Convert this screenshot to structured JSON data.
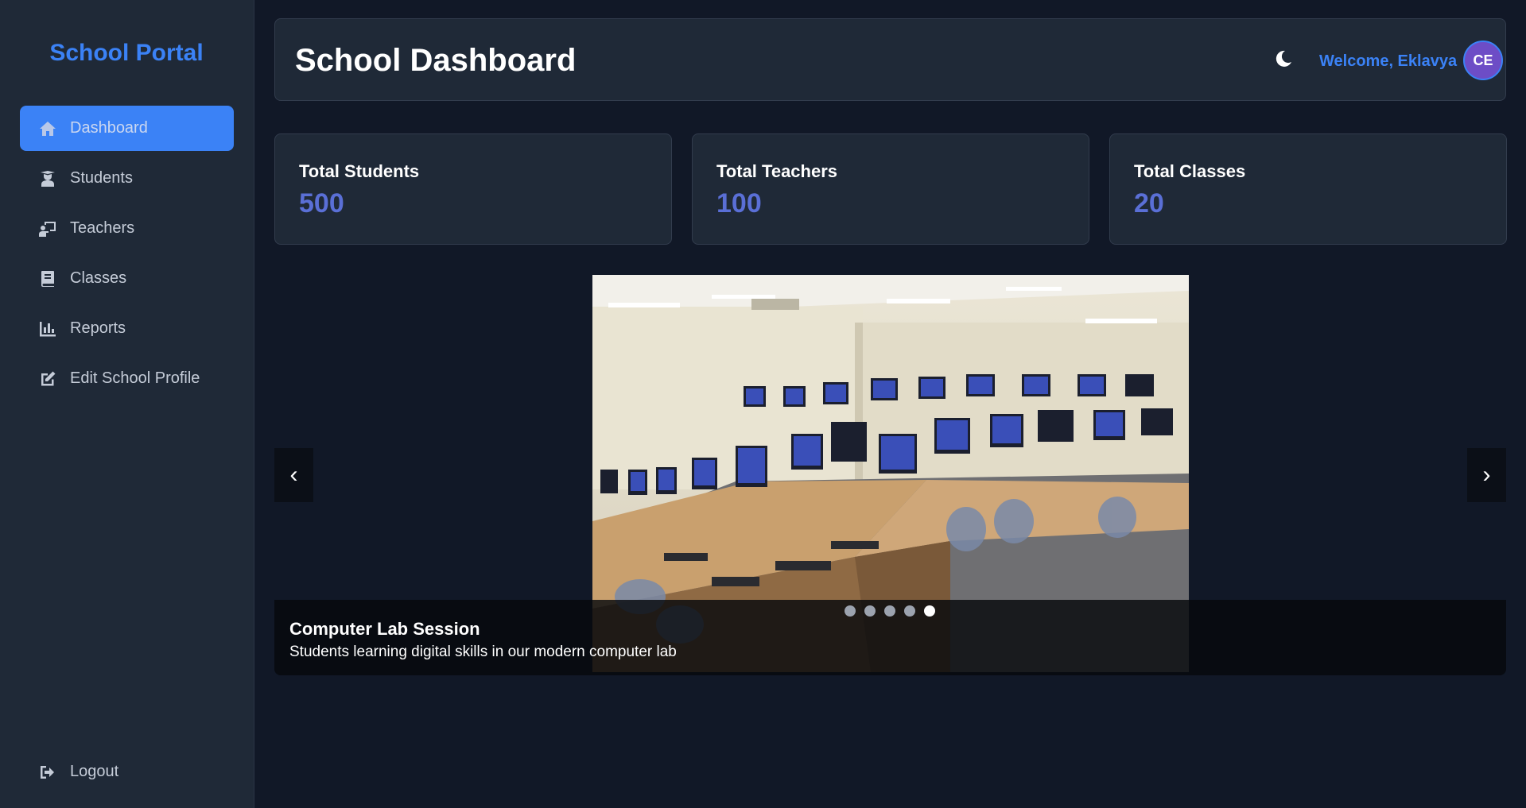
{
  "app": {
    "brand": "School Portal"
  },
  "sidebar": {
    "items": [
      {
        "label": "Dashboard",
        "icon": "home-icon",
        "active": true
      },
      {
        "label": "Students",
        "icon": "graduate-icon",
        "active": false
      },
      {
        "label": "Teachers",
        "icon": "teacher-icon",
        "active": false
      },
      {
        "label": "Classes",
        "icon": "book-icon",
        "active": false
      },
      {
        "label": "Reports",
        "icon": "chart-icon",
        "active": false
      },
      {
        "label": "Edit School Profile",
        "icon": "edit-icon",
        "active": false
      }
    ],
    "logout": {
      "label": "Logout",
      "icon": "logout-icon"
    }
  },
  "header": {
    "title": "School Dashboard",
    "theme_icon": "moon-icon",
    "welcome": "Welcome, Eklavya",
    "avatar_initials": "CE"
  },
  "stats": [
    {
      "label": "Total Students",
      "value": "500"
    },
    {
      "label": "Total Teachers",
      "value": "100"
    },
    {
      "label": "Total Classes",
      "value": "20"
    }
  ],
  "carousel": {
    "prev_label": "‹",
    "next_label": "›",
    "slide_title": "Computer Lab Session",
    "slide_text": "Students learning digital skills in our modern computer lab",
    "slide_count": 5,
    "active_slide": 5
  },
  "colors": {
    "accent": "#3b82f6",
    "stat_value": "#5a6fd6",
    "background": "#111827",
    "panel": "#1f2937"
  }
}
